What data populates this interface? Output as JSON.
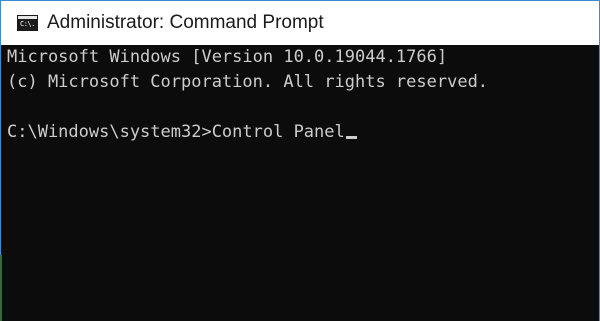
{
  "window": {
    "title": "Administrator: Command Prompt",
    "icon": "cmd-icon",
    "icon_text": "C:\\."
  },
  "console": {
    "lines": [
      "Microsoft Windows [Version 10.0.19044.1766]",
      "(c) Microsoft Corporation. All rights reserved.",
      "",
      "C:\\Windows\\system32>Control Panel"
    ]
  },
  "colors": {
    "console_bg": "#0c0c0c",
    "console_fg": "#cccccc",
    "titlebar_bg": "#ffffff",
    "window_border": "#3b8bd6"
  }
}
